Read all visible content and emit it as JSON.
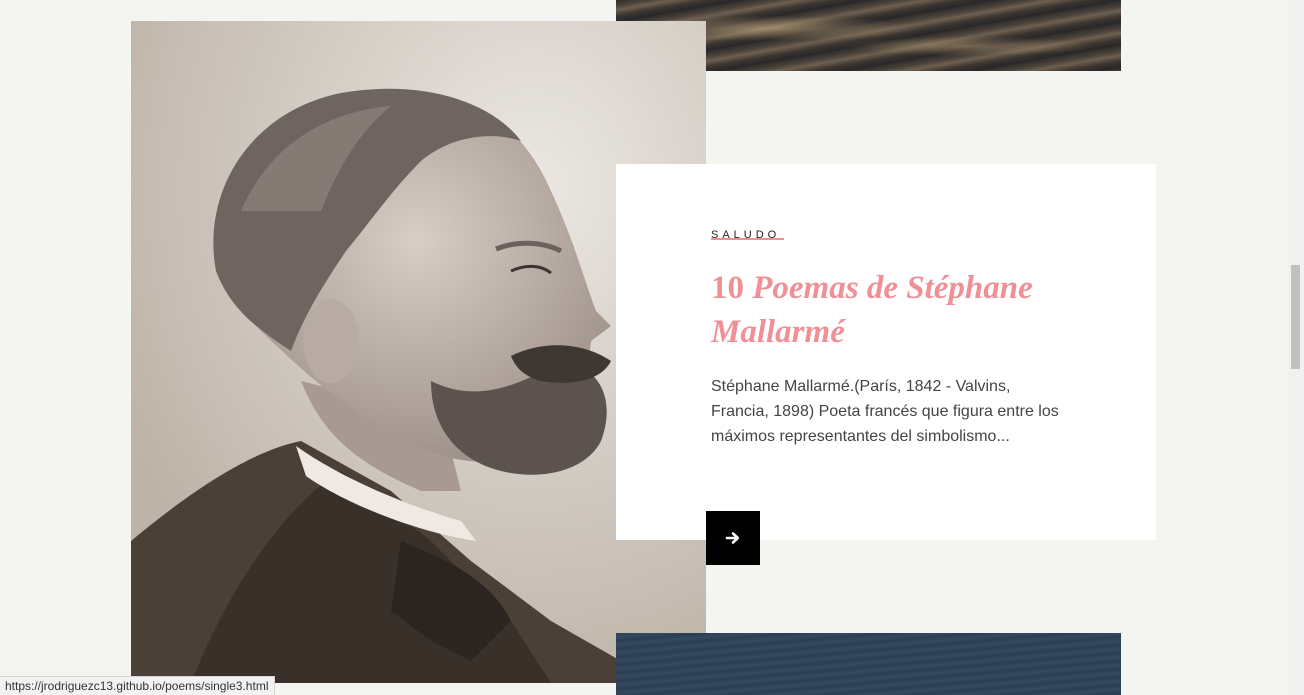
{
  "card": {
    "category": "SALUDO",
    "title_number": "10",
    "title_italic": "Poemas de Stéphane Mallarmé",
    "excerpt": "Stéphane Mallarmé.(París, 1842 - Valvins, Francia, 1898) Poeta francés que figura entre los máximos representantes del simbolismo...",
    "accent_color": "#ef8f96",
    "read_more_icon": "arrow-right-icon"
  },
  "status_bar": {
    "url": "https://jrodriguezc13.github.io/poems/single3.html"
  }
}
